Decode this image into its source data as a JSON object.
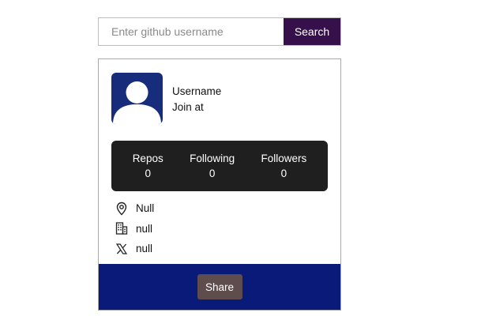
{
  "search": {
    "placeholder": "Enter github username",
    "value": "",
    "button_label": "Search"
  },
  "profile": {
    "avatar_icon": "user-silhouette-icon",
    "username": "Username",
    "join_text": "Join at"
  },
  "stats": [
    {
      "label": "Repos",
      "value": "0"
    },
    {
      "label": "Following",
      "value": "0"
    },
    {
      "label": "Followers",
      "value": "0"
    }
  ],
  "info": [
    {
      "icon": "location-pin-icon",
      "text": "Null"
    },
    {
      "icon": "building-icon",
      "text": "null"
    },
    {
      "icon": "x-twitter-icon",
      "text": "null"
    }
  ],
  "footer": {
    "share_label": "Share"
  },
  "colors": {
    "search_button": "#35104a",
    "avatar_bg": "#182c7c",
    "stats_bg": "#1f1f1f",
    "footer_bg": "#0a1a78",
    "share_button": "#5f4d4d"
  }
}
